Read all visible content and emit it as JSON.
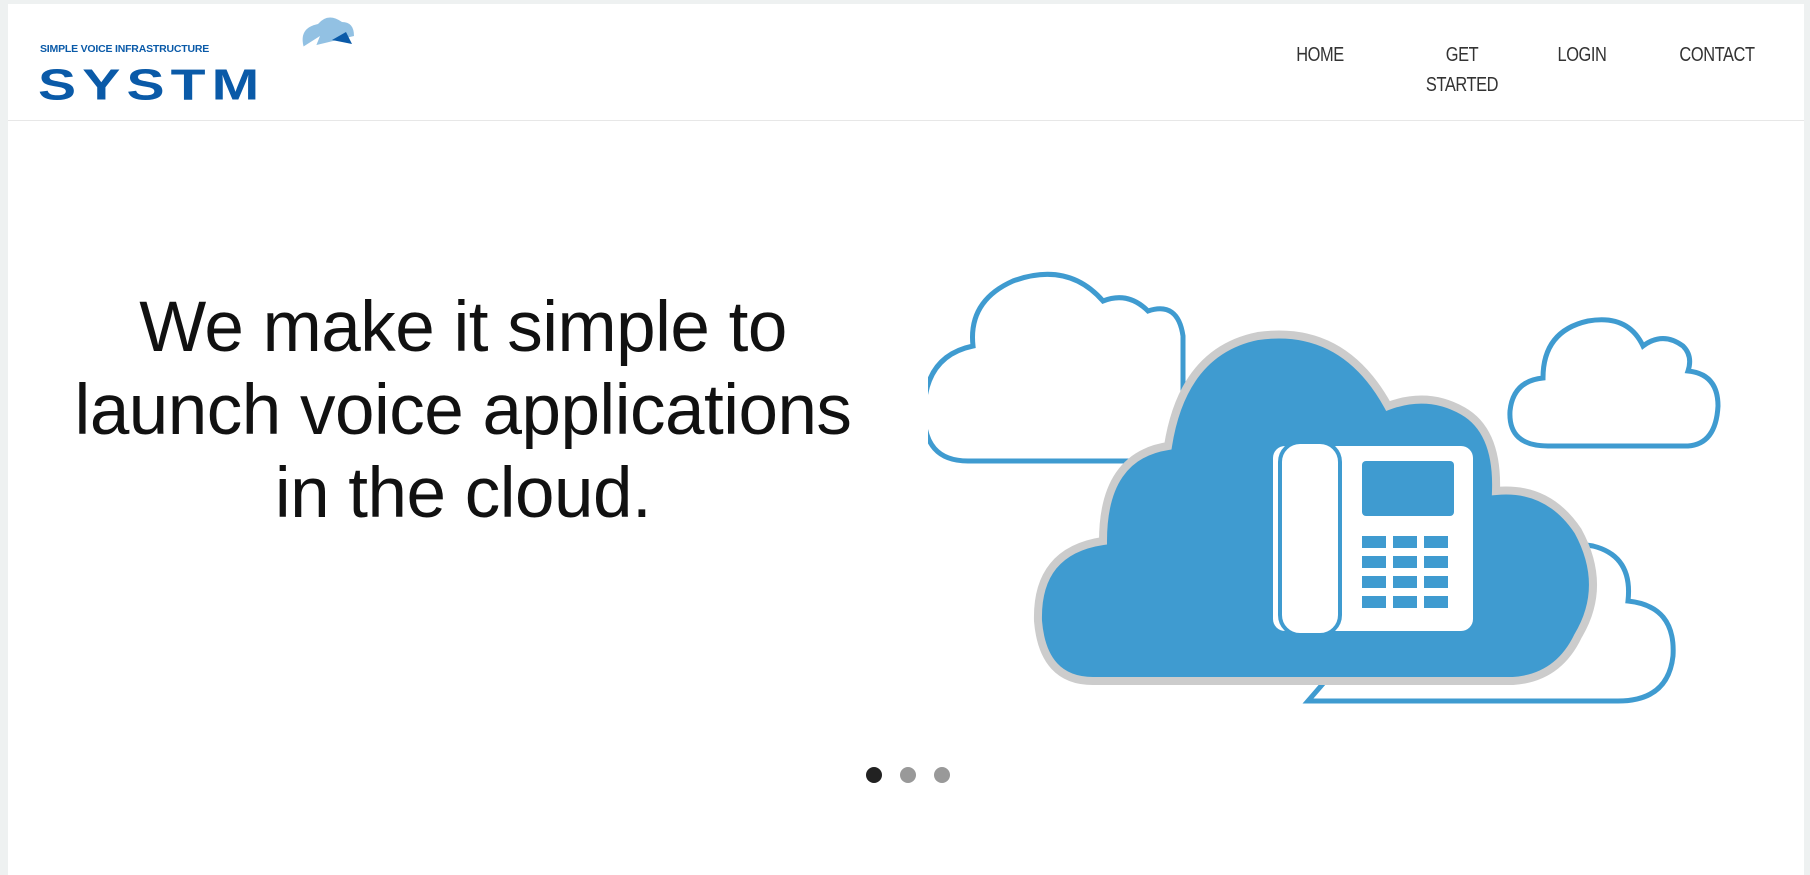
{
  "brand": {
    "tagline": "SIMPLE VOICE INFRASTRUCTURE",
    "name": "SYSTM",
    "primary_color": "#0a5aa8",
    "accent_color": "#4a9fd4"
  },
  "nav": {
    "items": [
      {
        "label": "HOME"
      },
      {
        "label": "GET STARTED"
      },
      {
        "label": "LOGIN"
      },
      {
        "label": "CONTACT"
      }
    ]
  },
  "hero": {
    "headline_lines": [
      "We make it simple to",
      "launch voice applications",
      "in the cloud."
    ],
    "illustration_icons": [
      "cloud-icon",
      "desk-phone-icon"
    ],
    "cloud_color": "#3f9bd0"
  },
  "carousel": {
    "slide_count": 3,
    "active_index": 0
  }
}
